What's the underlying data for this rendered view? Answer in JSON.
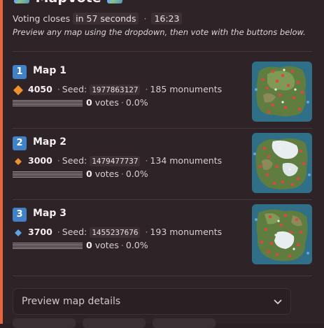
{
  "header": {
    "title": "MapVote"
  },
  "voting": {
    "prefix": "Voting closes",
    "time_left": "in 57 seconds",
    "separator": "·",
    "clock": "16:23"
  },
  "instructions": "Preview any map using the dropdown, then vote with the buttons below.",
  "maps": [
    {
      "number": "1",
      "title": "Map 1",
      "cost": "4050",
      "cost_icon": "orange-diamond-icon",
      "seed_label": "Seed:",
      "seed": "1977863127",
      "monuments": "185 monuments",
      "votes": "0",
      "votes_label": "votes",
      "percent": "0.0%",
      "vote_fraction": 0
    },
    {
      "number": "2",
      "title": "Map 2",
      "cost": "3000",
      "cost_icon": "small-orange-diamond-icon",
      "seed_label": "Seed:",
      "seed": "1479477737",
      "monuments": "134 monuments",
      "votes": "0",
      "votes_label": "votes",
      "percent": "0.0%",
      "vote_fraction": 0
    },
    {
      "number": "3",
      "title": "Map 3",
      "cost": "3700",
      "cost_icon": "small-blue-diamond-icon",
      "seed_label": "Seed:",
      "seed": "1455237676",
      "monuments": "193 monuments",
      "votes": "0",
      "votes_label": "votes",
      "percent": "0.0%",
      "vote_fraction": 0
    }
  ],
  "preview": {
    "placeholder": "Preview map details"
  },
  "colors": {
    "accent_bar": "#e8643c",
    "number_badge": "#3f82c8",
    "orange_diamond": "#f0922b",
    "blue_diamond": "#5aa7e6",
    "map_emoji": "#4a8fd1"
  }
}
